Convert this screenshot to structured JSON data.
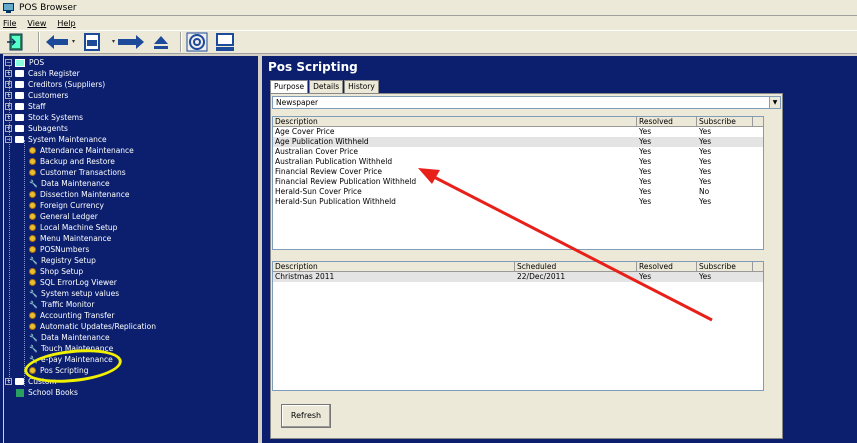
{
  "window": {
    "title": "POS Browser"
  },
  "menu": [
    {
      "label": "File"
    },
    {
      "label": "View"
    },
    {
      "label": "Help"
    }
  ],
  "tree": {
    "root": "POS",
    "items": [
      {
        "label": "Cash Register",
        "type": "folder"
      },
      {
        "label": "Creditors (Suppliers)",
        "type": "folder"
      },
      {
        "label": "Customers",
        "type": "folder"
      },
      {
        "label": "Staff",
        "type": "folder"
      },
      {
        "label": "Stock Systems",
        "type": "folder"
      },
      {
        "label": "Subagents",
        "type": "folder"
      },
      {
        "label": "System Maintenance",
        "type": "folder-open"
      },
      {
        "label": "Attendance Maintenance",
        "type": "gear"
      },
      {
        "label": "Backup and Restore",
        "type": "gear"
      },
      {
        "label": "Customer Transactions",
        "type": "gear"
      },
      {
        "label": "Data Maintenance",
        "type": "wrench"
      },
      {
        "label": "Dissection Maintenance",
        "type": "gear"
      },
      {
        "label": "Foreign Currency",
        "type": "gear"
      },
      {
        "label": "General Ledger",
        "type": "gear"
      },
      {
        "label": "Local Machine Setup",
        "type": "gear"
      },
      {
        "label": "Menu Maintenance",
        "type": "gear"
      },
      {
        "label": "POSNumbers",
        "type": "gear"
      },
      {
        "label": "Registry Setup",
        "type": "wrench"
      },
      {
        "label": "Shop Setup",
        "type": "gear"
      },
      {
        "label": "SQL ErrorLog Viewer",
        "type": "gear"
      },
      {
        "label": "System setup values",
        "type": "wrench"
      },
      {
        "label": "Traffic Monitor",
        "type": "wrench"
      },
      {
        "label": "Accounting Transfer",
        "type": "gear"
      },
      {
        "label": "Automatic Updates/Replication",
        "type": "gear"
      },
      {
        "label": "Data Maintenance",
        "type": "wrench"
      },
      {
        "label": "Touch Maintenance",
        "type": "wrench"
      },
      {
        "label": "e-pay Maintenance",
        "type": "wrench"
      },
      {
        "label": "Pos Scripting",
        "type": "gear"
      },
      {
        "label": "Custom",
        "type": "folder"
      },
      {
        "label": "School Books",
        "type": "book"
      }
    ]
  },
  "main": {
    "title": "Pos Scripting",
    "tabs": [
      {
        "label": "Purpose"
      },
      {
        "label": "Details"
      },
      {
        "label": "History"
      }
    ],
    "purpose_select": "Newspaper",
    "grid1": {
      "headers": [
        "Description",
        "Resolved",
        "Subscribe"
      ],
      "rows": [
        [
          "Age Cover Price",
          "Yes",
          "Yes"
        ],
        [
          "Age Publication Withheld",
          "Yes",
          "Yes"
        ],
        [
          "Australian Cover Price",
          "Yes",
          "Yes"
        ],
        [
          "Australian Publication Withheld",
          "Yes",
          "Yes"
        ],
        [
          "Financial Review Cover Price",
          "Yes",
          "Yes"
        ],
        [
          "Financial Review Publication Withheld",
          "Yes",
          "Yes"
        ],
        [
          "Herald-Sun Cover Price",
          "Yes",
          "No"
        ],
        [
          "Herald-Sun Publication Withheld",
          "Yes",
          "Yes"
        ]
      ]
    },
    "grid2": {
      "headers": [
        "Description",
        "Scheduled",
        "Resolved",
        "Subscribe"
      ],
      "rows": [
        [
          "Christmas 2011",
          "22/Dec/2011",
          "Yes",
          "Yes"
        ]
      ]
    },
    "refresh_label": "Refresh"
  },
  "colors": {
    "background": "#0b1f6e",
    "annotation_arrow": "#e8201a",
    "annotation_circle": "#f0f000"
  }
}
